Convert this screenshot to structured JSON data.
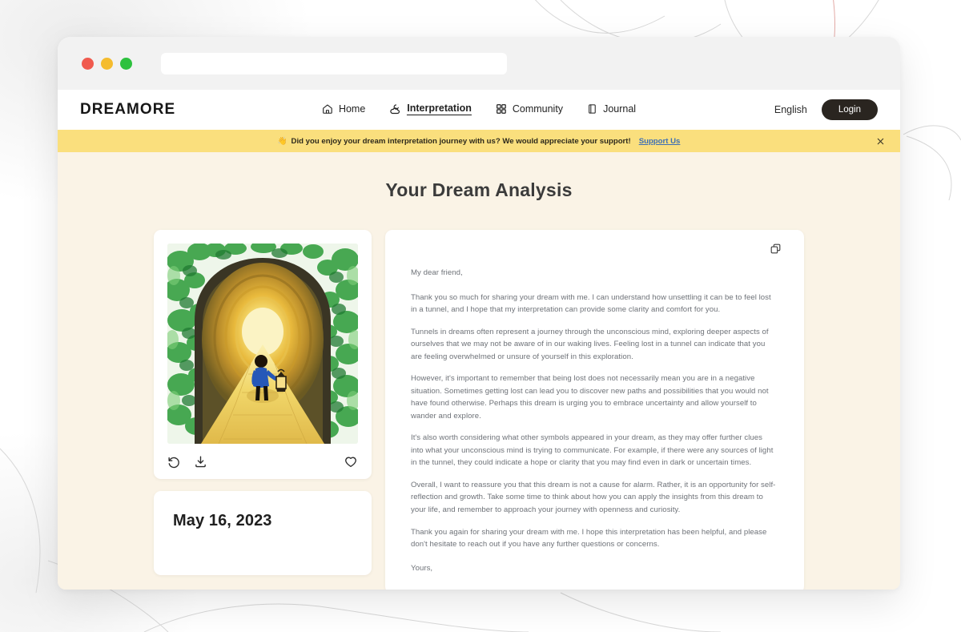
{
  "browser": {
    "url_value": "",
    "url_placeholder": "",
    "window_controls": [
      "close",
      "minimize",
      "maximize"
    ]
  },
  "header": {
    "brand": "DREAMORE",
    "nav": [
      {
        "label": "Home",
        "icon": "home-icon",
        "active": false
      },
      {
        "label": "Interpretation",
        "icon": "cloud-moon-icon",
        "active": true
      },
      {
        "label": "Community",
        "icon": "grid-icon",
        "active": false
      },
      {
        "label": "Journal",
        "icon": "book-icon",
        "active": false
      }
    ],
    "language": "English",
    "login_label": "Login"
  },
  "banner": {
    "emoji": "👋",
    "text": "Did you enjoy your dream interpretation journey with us? We would appreciate your support!",
    "link_label": "Support Us",
    "close_label": "×",
    "background_color": "#fadf7d",
    "link_color": "#3d6fb5"
  },
  "main": {
    "title": "Your Dream Analysis",
    "background_color": "#faf3e6",
    "image_card": {
      "alt": "Watercolor illustration of a child holding a lantern walking through a glowing tunnel surrounded by green foliage",
      "actions": [
        {
          "name": "regenerate",
          "icon": "rotate-ccw-icon"
        },
        {
          "name": "download",
          "icon": "download-icon"
        },
        {
          "name": "favorite",
          "icon": "heart-icon"
        }
      ]
    },
    "date_card": {
      "date": "May 16, 2023",
      "subtitle": ""
    },
    "letter": {
      "copy_icon": "copy-icon",
      "salutation": "My dear friend,",
      "paragraphs": [
        "Thank you so much for sharing your dream with me. I can understand how unsettling it can be to feel lost in a tunnel, and I hope that my interpretation can provide some clarity and comfort for you.",
        "Tunnels in dreams often represent a journey through the unconscious mind, exploring deeper aspects of ourselves that we may not be aware of in our waking lives. Feeling lost in a tunnel can indicate that you are feeling overwhelmed or unsure of yourself in this exploration.",
        "However, it's important to remember that being lost does not necessarily mean you are in a negative situation. Sometimes getting lost can lead you to discover new paths and possibilities that you would not have found otherwise. Perhaps this dream is urging you to embrace uncertainty and allow yourself to wander and explore.",
        "It's also worth considering what other symbols appeared in your dream, as they may offer further clues into what your unconscious mind is trying to communicate. For example, if there were any sources of light in the tunnel, they could indicate a hope or clarity that you may find even in dark or uncertain times.",
        "Overall, I want to reassure you that this dream is not a cause for alarm. Rather, it is an opportunity for self-reflection and growth. Take some time to think about how you can apply the insights from this dream to your life, and remember to approach your journey with openness and curiosity.",
        "Thank you again for sharing your dream with me. I hope this interpretation has been helpful, and please don't hesitate to reach out if you have any further questions or concerns."
      ],
      "signoff": "Yours,"
    }
  }
}
